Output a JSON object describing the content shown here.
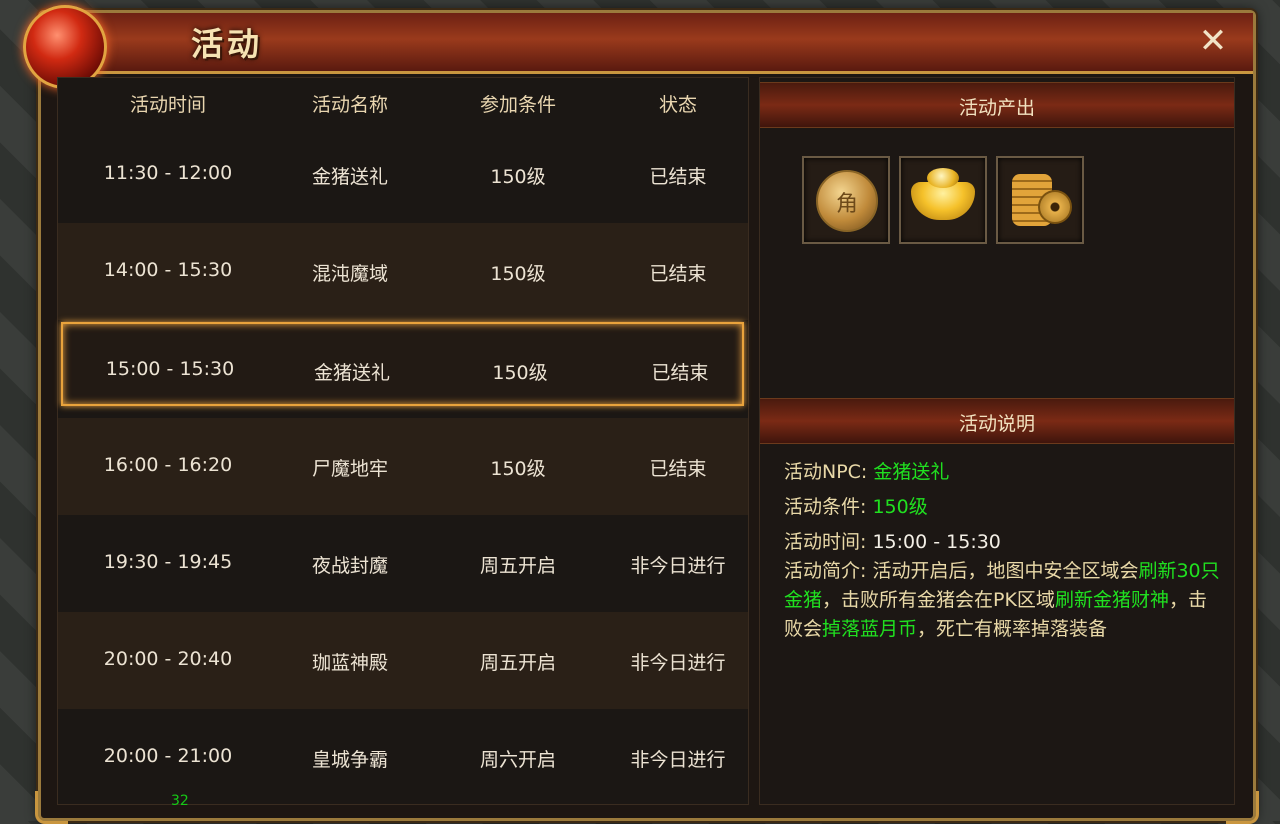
{
  "window": {
    "title": "活动",
    "close_label": "✕"
  },
  "table": {
    "headers": [
      "活动时间",
      "活动名称",
      "参加条件",
      "状态"
    ],
    "rows": [
      {
        "time": "11:30 - 12:00",
        "name": "金猪送礼",
        "condition": "150级",
        "status": "已结束"
      },
      {
        "time": "14:00 - 15:30",
        "name": "混沌魔域",
        "condition": "150级",
        "status": "已结束"
      },
      {
        "time": "15:00 - 15:30",
        "name": "金猪送礼",
        "condition": "150级",
        "status": "已结束",
        "selected": true
      },
      {
        "time": "16:00 - 16:20",
        "name": "尸魔地牢",
        "condition": "150级",
        "status": "已结束"
      },
      {
        "time": "19:30 - 19:45",
        "name": "夜战封魔",
        "condition": "周五开启",
        "status": "非今日进行"
      },
      {
        "time": "20:00 - 20:40",
        "name": "珈蓝神殿",
        "condition": "周五开启",
        "status": "非今日进行"
      },
      {
        "time": "20:00 - 21:00",
        "name": "皇城争霸",
        "condition": "周六开启",
        "status": "非今日进行"
      }
    ],
    "page_number": "32"
  },
  "rewards": {
    "title": "活动产出",
    "items": [
      {
        "icon": "bronze-coin-icon"
      },
      {
        "icon": "gold-ingot-icon"
      },
      {
        "icon": "coin-stack-icon"
      }
    ]
  },
  "description": {
    "title": "活动说明",
    "npc_label": "活动NPC: ",
    "npc_value": "金猪送礼",
    "condition_label": "活动条件: ",
    "condition_value": "150级",
    "time_label": "活动时间: ",
    "time_value": "15:00 - 15:30",
    "intro_label": "活动简介:   ",
    "intro_part1": "活动开启后，地图中安全区域会",
    "intro_part2": "刷新30只金猪",
    "intro_part3": "，击败所有金猪会在PK区域",
    "intro_part4": "刷新金猪财神",
    "intro_part5": "，击败会",
    "intro_part6": "掉落蓝月币",
    "intro_part7": "，死亡有概率掉落装备"
  },
  "colors": {
    "highlight": "#20e020",
    "accent_gold": "#e9a33c"
  }
}
